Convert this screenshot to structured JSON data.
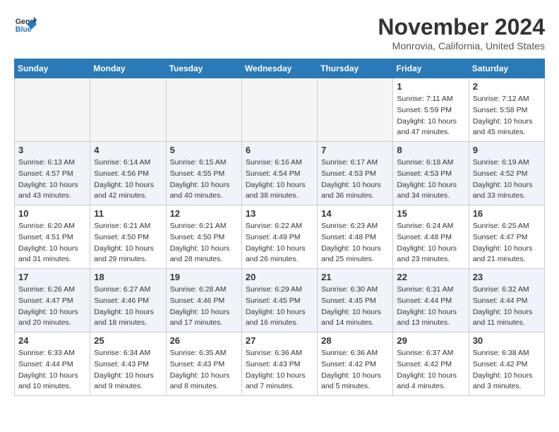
{
  "header": {
    "logo_line1": "General",
    "logo_line2": "Blue",
    "month": "November 2024",
    "location": "Monrovia, California, United States"
  },
  "weekdays": [
    "Sunday",
    "Monday",
    "Tuesday",
    "Wednesday",
    "Thursday",
    "Friday",
    "Saturday"
  ],
  "weeks": [
    [
      {
        "day": "",
        "empty": true
      },
      {
        "day": "",
        "empty": true
      },
      {
        "day": "",
        "empty": true
      },
      {
        "day": "",
        "empty": true
      },
      {
        "day": "",
        "empty": true
      },
      {
        "day": "1",
        "sunrise": "7:11 AM",
        "sunset": "5:59 PM",
        "daylight": "10 hours and 47 minutes."
      },
      {
        "day": "2",
        "sunrise": "7:12 AM",
        "sunset": "5:58 PM",
        "daylight": "10 hours and 45 minutes."
      }
    ],
    [
      {
        "day": "3",
        "sunrise": "6:13 AM",
        "sunset": "4:57 PM",
        "daylight": "10 hours and 43 minutes."
      },
      {
        "day": "4",
        "sunrise": "6:14 AM",
        "sunset": "4:56 PM",
        "daylight": "10 hours and 42 minutes."
      },
      {
        "day": "5",
        "sunrise": "6:15 AM",
        "sunset": "4:55 PM",
        "daylight": "10 hours and 40 minutes."
      },
      {
        "day": "6",
        "sunrise": "6:16 AM",
        "sunset": "4:54 PM",
        "daylight": "10 hours and 38 minutes."
      },
      {
        "day": "7",
        "sunrise": "6:17 AM",
        "sunset": "4:53 PM",
        "daylight": "10 hours and 36 minutes."
      },
      {
        "day": "8",
        "sunrise": "6:18 AM",
        "sunset": "4:53 PM",
        "daylight": "10 hours and 34 minutes."
      },
      {
        "day": "9",
        "sunrise": "6:19 AM",
        "sunset": "4:52 PM",
        "daylight": "10 hours and 33 minutes."
      }
    ],
    [
      {
        "day": "10",
        "sunrise": "6:20 AM",
        "sunset": "4:51 PM",
        "daylight": "10 hours and 31 minutes."
      },
      {
        "day": "11",
        "sunrise": "6:21 AM",
        "sunset": "4:50 PM",
        "daylight": "10 hours and 29 minutes."
      },
      {
        "day": "12",
        "sunrise": "6:21 AM",
        "sunset": "4:50 PM",
        "daylight": "10 hours and 28 minutes."
      },
      {
        "day": "13",
        "sunrise": "6:22 AM",
        "sunset": "4:49 PM",
        "daylight": "10 hours and 26 minutes."
      },
      {
        "day": "14",
        "sunrise": "6:23 AM",
        "sunset": "4:48 PM",
        "daylight": "10 hours and 25 minutes."
      },
      {
        "day": "15",
        "sunrise": "6:24 AM",
        "sunset": "4:48 PM",
        "daylight": "10 hours and 23 minutes."
      },
      {
        "day": "16",
        "sunrise": "6:25 AM",
        "sunset": "4:47 PM",
        "daylight": "10 hours and 21 minutes."
      }
    ],
    [
      {
        "day": "17",
        "sunrise": "6:26 AM",
        "sunset": "4:47 PM",
        "daylight": "10 hours and 20 minutes."
      },
      {
        "day": "18",
        "sunrise": "6:27 AM",
        "sunset": "4:46 PM",
        "daylight": "10 hours and 18 minutes."
      },
      {
        "day": "19",
        "sunrise": "6:28 AM",
        "sunset": "4:46 PM",
        "daylight": "10 hours and 17 minutes."
      },
      {
        "day": "20",
        "sunrise": "6:29 AM",
        "sunset": "4:45 PM",
        "daylight": "10 hours and 16 minutes."
      },
      {
        "day": "21",
        "sunrise": "6:30 AM",
        "sunset": "4:45 PM",
        "daylight": "10 hours and 14 minutes."
      },
      {
        "day": "22",
        "sunrise": "6:31 AM",
        "sunset": "4:44 PM",
        "daylight": "10 hours and 13 minutes."
      },
      {
        "day": "23",
        "sunrise": "6:32 AM",
        "sunset": "4:44 PM",
        "daylight": "10 hours and 11 minutes."
      }
    ],
    [
      {
        "day": "24",
        "sunrise": "6:33 AM",
        "sunset": "4:44 PM",
        "daylight": "10 hours and 10 minutes."
      },
      {
        "day": "25",
        "sunrise": "6:34 AM",
        "sunset": "4:43 PM",
        "daylight": "10 hours and 9 minutes."
      },
      {
        "day": "26",
        "sunrise": "6:35 AM",
        "sunset": "4:43 PM",
        "daylight": "10 hours and 8 minutes."
      },
      {
        "day": "27",
        "sunrise": "6:36 AM",
        "sunset": "4:43 PM",
        "daylight": "10 hours and 7 minutes."
      },
      {
        "day": "28",
        "sunrise": "6:36 AM",
        "sunset": "4:42 PM",
        "daylight": "10 hours and 5 minutes."
      },
      {
        "day": "29",
        "sunrise": "6:37 AM",
        "sunset": "4:42 PM",
        "daylight": "10 hours and 4 minutes."
      },
      {
        "day": "30",
        "sunrise": "6:38 AM",
        "sunset": "4:42 PM",
        "daylight": "10 hours and 3 minutes."
      }
    ]
  ]
}
